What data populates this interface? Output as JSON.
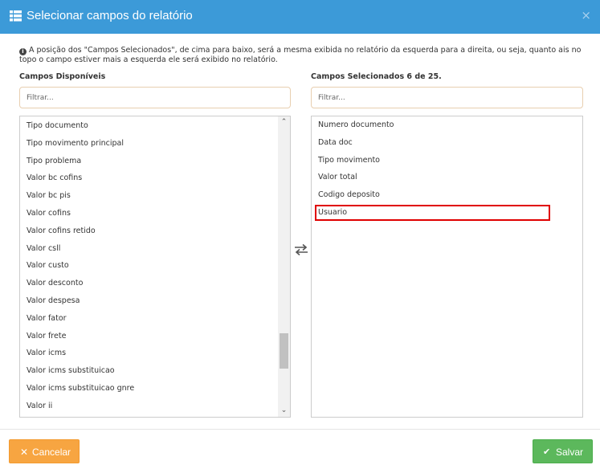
{
  "header": {
    "title": "Selecionar campos do relatório",
    "title_icon": "list-icon",
    "close_label": "×"
  },
  "info": {
    "icon": "info-circle-icon",
    "text": "A posição dos \"Campos Selecionados\", de cima para baixo, será a mesma exibida no relatório da esquerda para a direita, ou seja, quanto ais no topo o campo estiver mais a esquerda ele será exibido no relatório."
  },
  "available": {
    "label": "Campos Disponíveis",
    "filter_placeholder": "Filtrar...",
    "items": [
      "Tipo documento",
      "Tipo movimento principal",
      "Tipo problema",
      "Valor bc cofins",
      "Valor bc pis",
      "Valor cofins",
      "Valor cofins retido",
      "Valor csll",
      "Valor custo",
      "Valor desconto",
      "Valor despesa",
      "Valor fator",
      "Valor frete",
      "Valor icms",
      "Valor icms substituicao",
      "Valor icms substituicao gnre",
      "Valor ii"
    ]
  },
  "selected": {
    "label": "Campos Selecionados 6 de 25.",
    "filter_placeholder": "Filtrar...",
    "items": [
      "Numero documento",
      "Data doc",
      "Tipo movimento",
      "Valor total",
      "Codigo deposito",
      "Usuario"
    ]
  },
  "transfer_icon": "exchange-arrows-icon",
  "footer": {
    "cancel_label": "Cancelar",
    "cancel_icon": "times-icon",
    "save_label": "Salvar",
    "save_icon": "check-icon"
  },
  "colors": {
    "header": "#3c9ad8",
    "cancel": "#f7a541",
    "save": "#5cb85c",
    "highlight": "#e00000"
  }
}
